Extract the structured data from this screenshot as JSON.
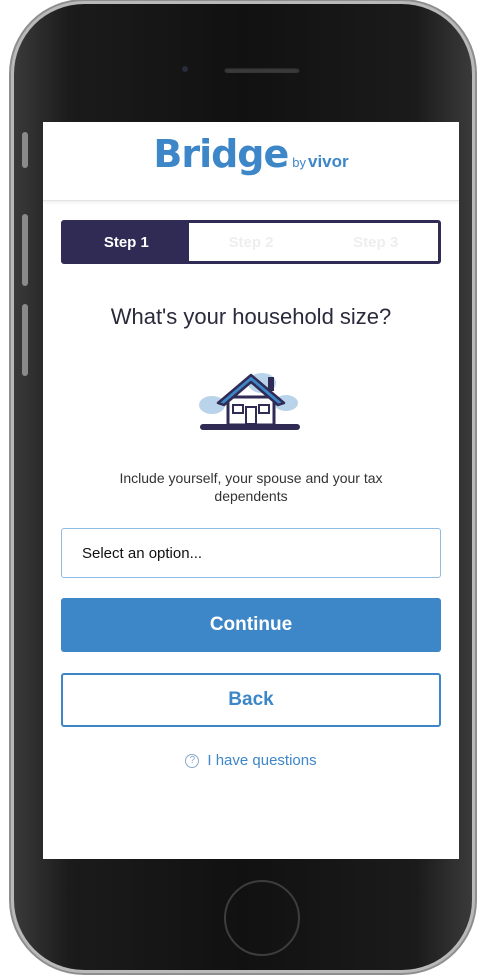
{
  "brand": {
    "name": "Bridge",
    "by": "by",
    "sub": "vivor"
  },
  "steps": [
    {
      "label": "Step 1",
      "active": true
    },
    {
      "label": "Step 2",
      "active": false
    },
    {
      "label": "Step 3",
      "active": false
    }
  ],
  "question": {
    "title": "What's your household size?"
  },
  "illustration": {
    "icon": "house-icon"
  },
  "hint": "Include yourself, your spouse and your tax dependents",
  "select": {
    "placeholder": "Select an option..."
  },
  "buttons": {
    "continue_label": "Continue",
    "back_label": "Back"
  },
  "help": {
    "icon": "question-circle-icon",
    "label": "I have questions"
  },
  "colors": {
    "accent": "#3d86c8",
    "step_active": "#2f2b55",
    "text": "#2a2a3c"
  }
}
